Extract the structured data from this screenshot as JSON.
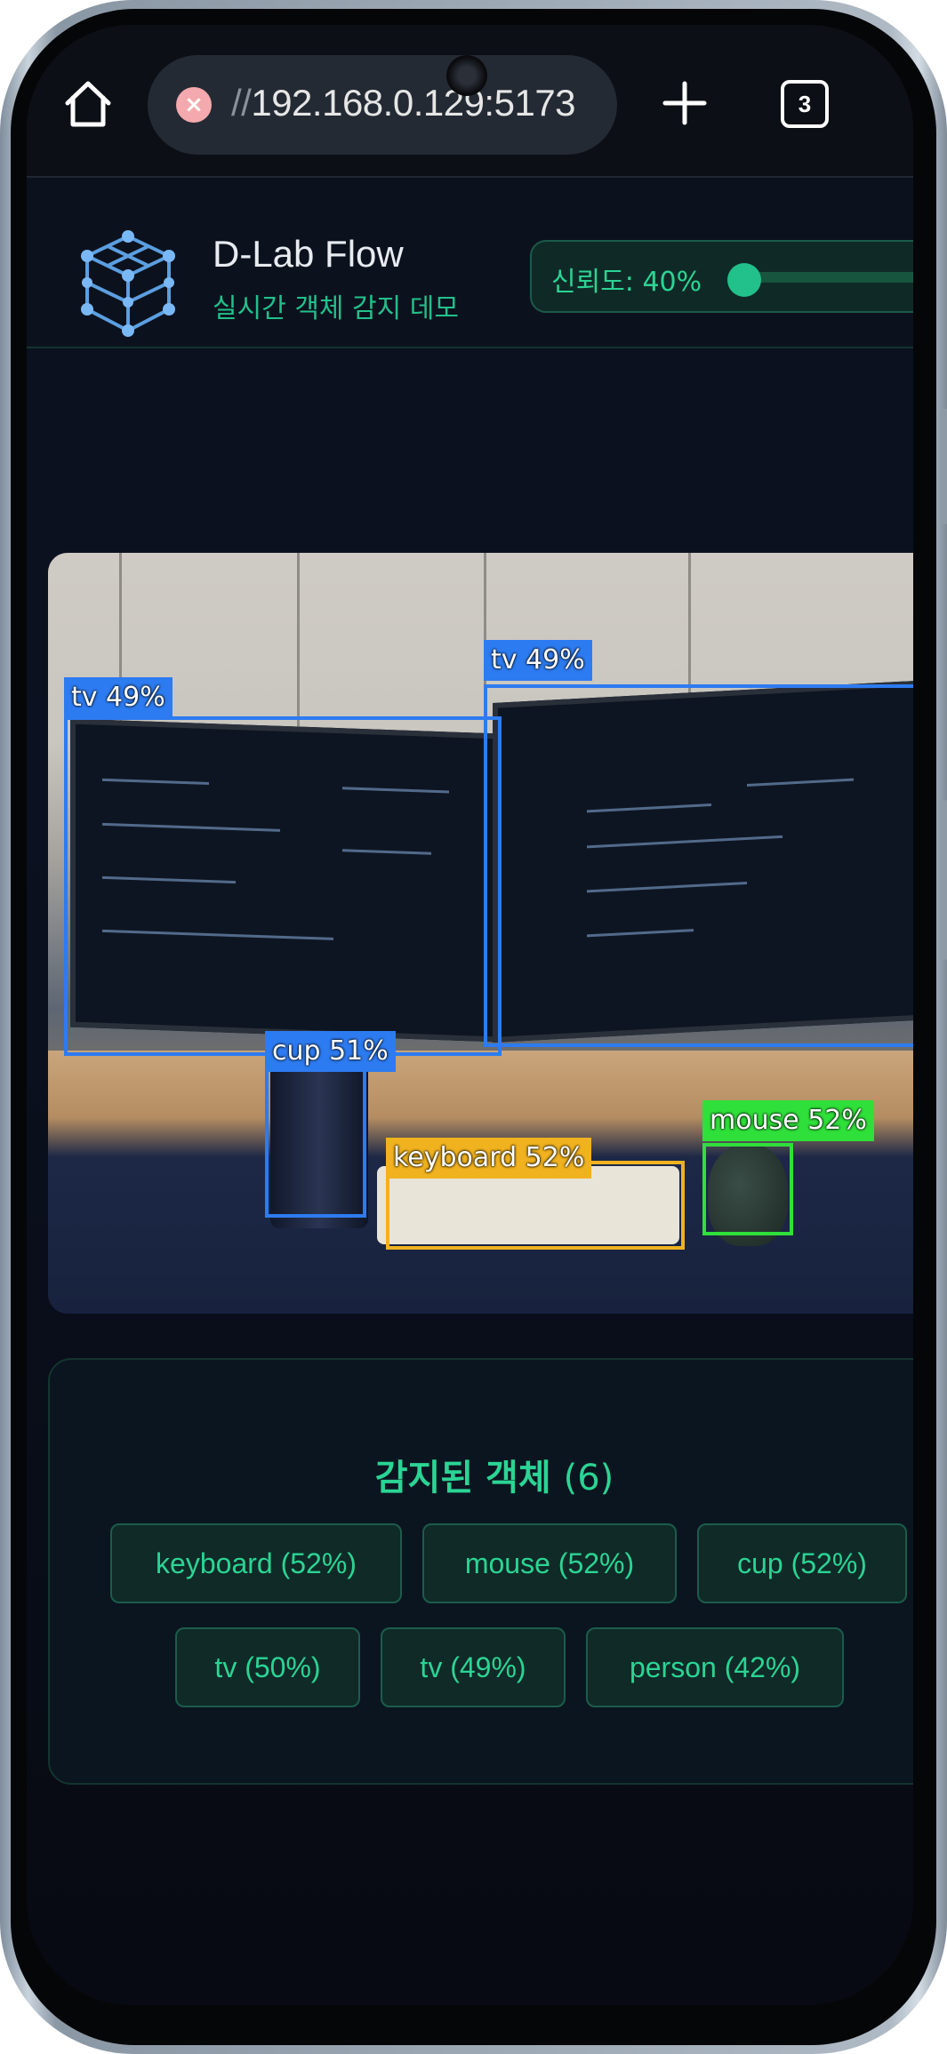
{
  "browser": {
    "url_prefix": "//",
    "url_host": "192.168.0.129:5173",
    "tab_count": "3",
    "icons": {
      "home": "home-icon",
      "security": "not-secure-icon",
      "new_tab": "plus-icon",
      "tabs": "tab-switcher-icon"
    }
  },
  "header": {
    "title": "D-Lab Flow",
    "subtitle": "실시간 객체 감지 데모",
    "confidence_label": "신뢰도: 40%",
    "confidence_value": 0.4
  },
  "detections_overlay": [
    {
      "label": "tv 49%",
      "color": "#2d7bf0"
    },
    {
      "label": "tv 49%",
      "color": "#2d7bf0"
    },
    {
      "label": "cup 51%",
      "color": "#2d7bf0"
    },
    {
      "label": "keyboard 52%",
      "color": "#f0b21e"
    },
    {
      "label": "mouse 52%",
      "color": "#2fe03a"
    }
  ],
  "detected_panel": {
    "title": "감지된 객체",
    "count": "(6)",
    "items": [
      {
        "label": "keyboard (52%)"
      },
      {
        "label": "mouse (52%)"
      },
      {
        "label": "cup (52%)"
      },
      {
        "label": "tv (50%)"
      },
      {
        "label": "tv (49%)"
      },
      {
        "label": "person (42%)"
      }
    ]
  },
  "colors": {
    "accent": "#22c08b",
    "box_blue": "#2d7bf0",
    "box_yellow": "#f0b21e",
    "box_green": "#2fe03a"
  }
}
